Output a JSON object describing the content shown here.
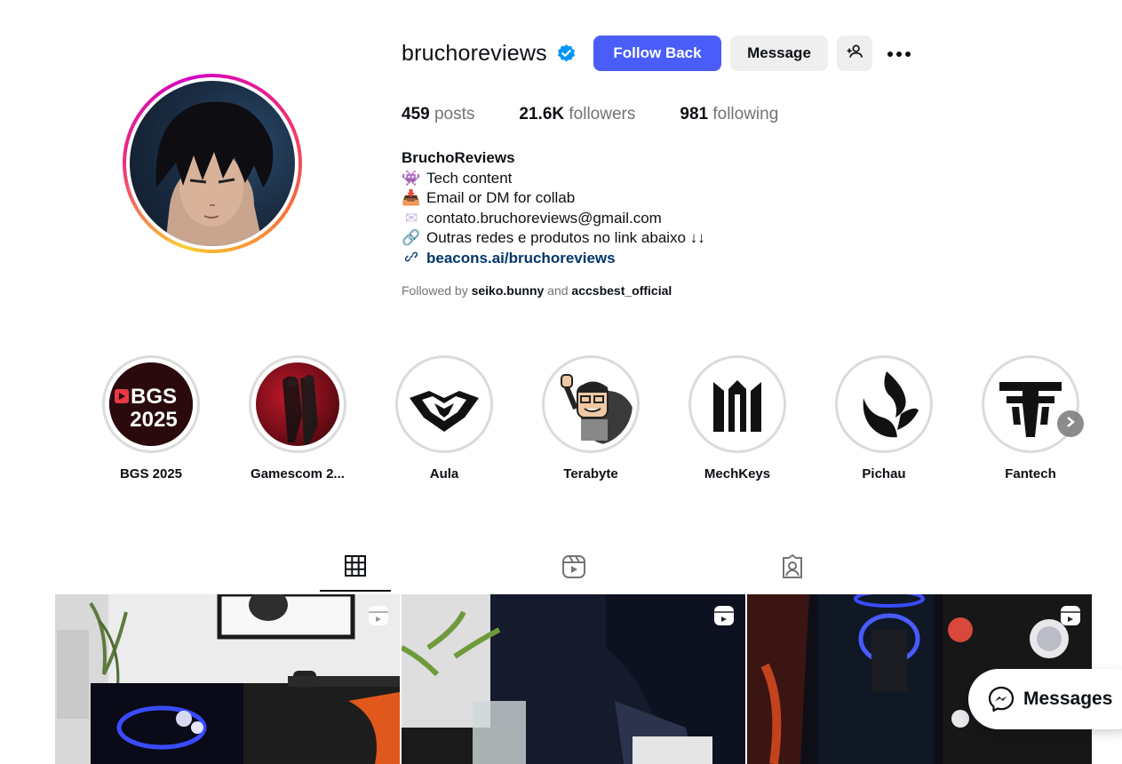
{
  "profile": {
    "username": "bruchoreviews",
    "follow_button": "Follow Back",
    "message_button": "Message",
    "stats": {
      "posts_count": "459",
      "posts_label": "posts",
      "followers_count": "21.6K",
      "followers_label": "followers",
      "following_count": "981",
      "following_label": "following"
    },
    "bio": {
      "name": "BruchoReviews",
      "lines": [
        {
          "emoji": "👾",
          "text": "Tech content"
        },
        {
          "emoji": "📥",
          "text": "Email or DM for collab"
        },
        {
          "emoji": "✉",
          "text": "contato.bruchoreviews@gmail.com"
        },
        {
          "emoji": "🔗",
          "text": "Outras redes e produtos no link abaixo ↓↓"
        }
      ],
      "link": "beacons.ai/bruchoreviews"
    },
    "followed_by": {
      "prefix": "Followed by",
      "user1": "seiko.bunny",
      "conjunction": "and",
      "user2": "accsbest_official"
    }
  },
  "highlights": [
    {
      "label": "BGS 2025",
      "icon": "bgs-2025-logo"
    },
    {
      "label": "Gamescom 2...",
      "icon": "gamescom-photo"
    },
    {
      "label": "Aula",
      "icon": "aula-logo"
    },
    {
      "label": "Terabyte",
      "icon": "terabyte-mascot"
    },
    {
      "label": "MechKeys",
      "icon": "mechkeys-logo"
    },
    {
      "label": "Pichau",
      "icon": "pichau-logo"
    },
    {
      "label": "Fantech",
      "icon": "fantech-logo"
    }
  ],
  "highlight_logo_text": {
    "bgs": "BGS",
    "year": "2025"
  },
  "tabs": [
    {
      "name": "posts",
      "icon": "grid-icon",
      "active": true
    },
    {
      "name": "reels",
      "icon": "reels-icon",
      "active": false
    },
    {
      "name": "tagged",
      "icon": "tagged-icon",
      "active": false
    }
  ],
  "posts": [
    {
      "type": "reel",
      "icon": "reels-icon"
    },
    {
      "type": "reel",
      "icon": "reels-icon"
    },
    {
      "type": "reel",
      "icon": "reels-icon"
    }
  ],
  "messages_button": "Messages",
  "colors": {
    "follow_button": "#4a5df9",
    "verified": "#0095f6",
    "link": "#00376b",
    "secondary_text": "#737373"
  }
}
